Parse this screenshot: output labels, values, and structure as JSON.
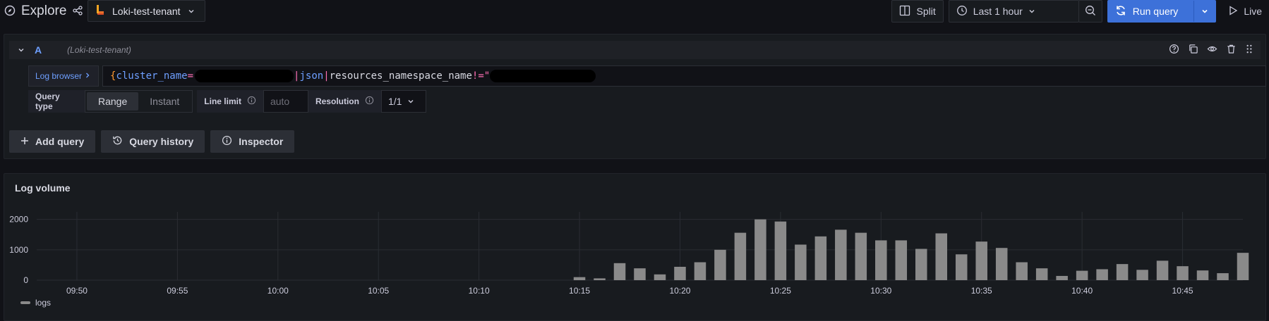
{
  "topbar": {
    "title": "Explore",
    "datasource": "Loki-test-tenant",
    "split_label": "Split",
    "time_range": "Last 1 hour",
    "run_query_label": "Run query",
    "live_label": "Live"
  },
  "query": {
    "ref": "A",
    "datasource": "(Loki-test-tenant)",
    "log_browser_label": "Log browser",
    "expression": {
      "open_brace": "{",
      "label_cluster": "cluster_name",
      "eq": "=",
      "pipe1": "|",
      "json": "json",
      "pipe2": "|",
      "label_ns": "resources_namespace_name",
      "neq": "!=",
      "quote": "\""
    },
    "query_type_label": "Query type",
    "query_type_options": [
      "Range",
      "Instant"
    ],
    "query_type_selected": "Range",
    "line_limit_label": "Line limit",
    "line_limit_placeholder": "auto",
    "resolution_label": "Resolution",
    "resolution_value": "1/1"
  },
  "actions": {
    "add_query": "Add query",
    "query_history": "Query history",
    "inspector": "Inspector"
  },
  "log_volume": {
    "title": "Log volume"
  },
  "chart_data": {
    "type": "bar",
    "title": "Log volume",
    "x": [
      "10:15",
      "10:16",
      "10:17",
      "10:18",
      "10:19",
      "10:20",
      "10:21",
      "10:22",
      "10:23",
      "10:24",
      "10:25",
      "10:26",
      "10:27",
      "10:28",
      "10:29",
      "10:30",
      "10:31",
      "10:32",
      "10:33",
      "10:34",
      "10:35",
      "10:36",
      "10:37",
      "10:38",
      "10:39",
      "10:40",
      "10:41",
      "10:42",
      "10:43",
      "10:44",
      "10:45",
      "10:46",
      "10:47",
      "10:48"
    ],
    "series": [
      {
        "name": "logs",
        "values": [
          100,
          60,
          560,
          390,
          190,
          440,
          590,
          1000,
          1560,
          2000,
          1930,
          1170,
          1440,
          1660,
          1560,
          1310,
          1310,
          1030,
          1540,
          850,
          1270,
          1060,
          590,
          390,
          140,
          310,
          360,
          530,
          340,
          640,
          460,
          320,
          230,
          900
        ]
      }
    ],
    "x_ticks": [
      "09:50",
      "09:55",
      "10:00",
      "10:05",
      "10:10",
      "10:15",
      "10:20",
      "10:25",
      "10:30",
      "10:35",
      "10:40",
      "10:45"
    ],
    "y_ticks": [
      0,
      1000,
      2000
    ],
    "ylim": [
      0,
      2200
    ],
    "xlim_minutes": [
      "09:48",
      "10:48"
    ],
    "legend": "bottom-left",
    "grid": true,
    "colors": {
      "bars": "#8a8a8a",
      "grid": "#2a2d33"
    }
  },
  "colors": {
    "background": "#111217",
    "panel": "#181b1f",
    "primary": "#3d71d9",
    "link": "#6e9fff"
  }
}
